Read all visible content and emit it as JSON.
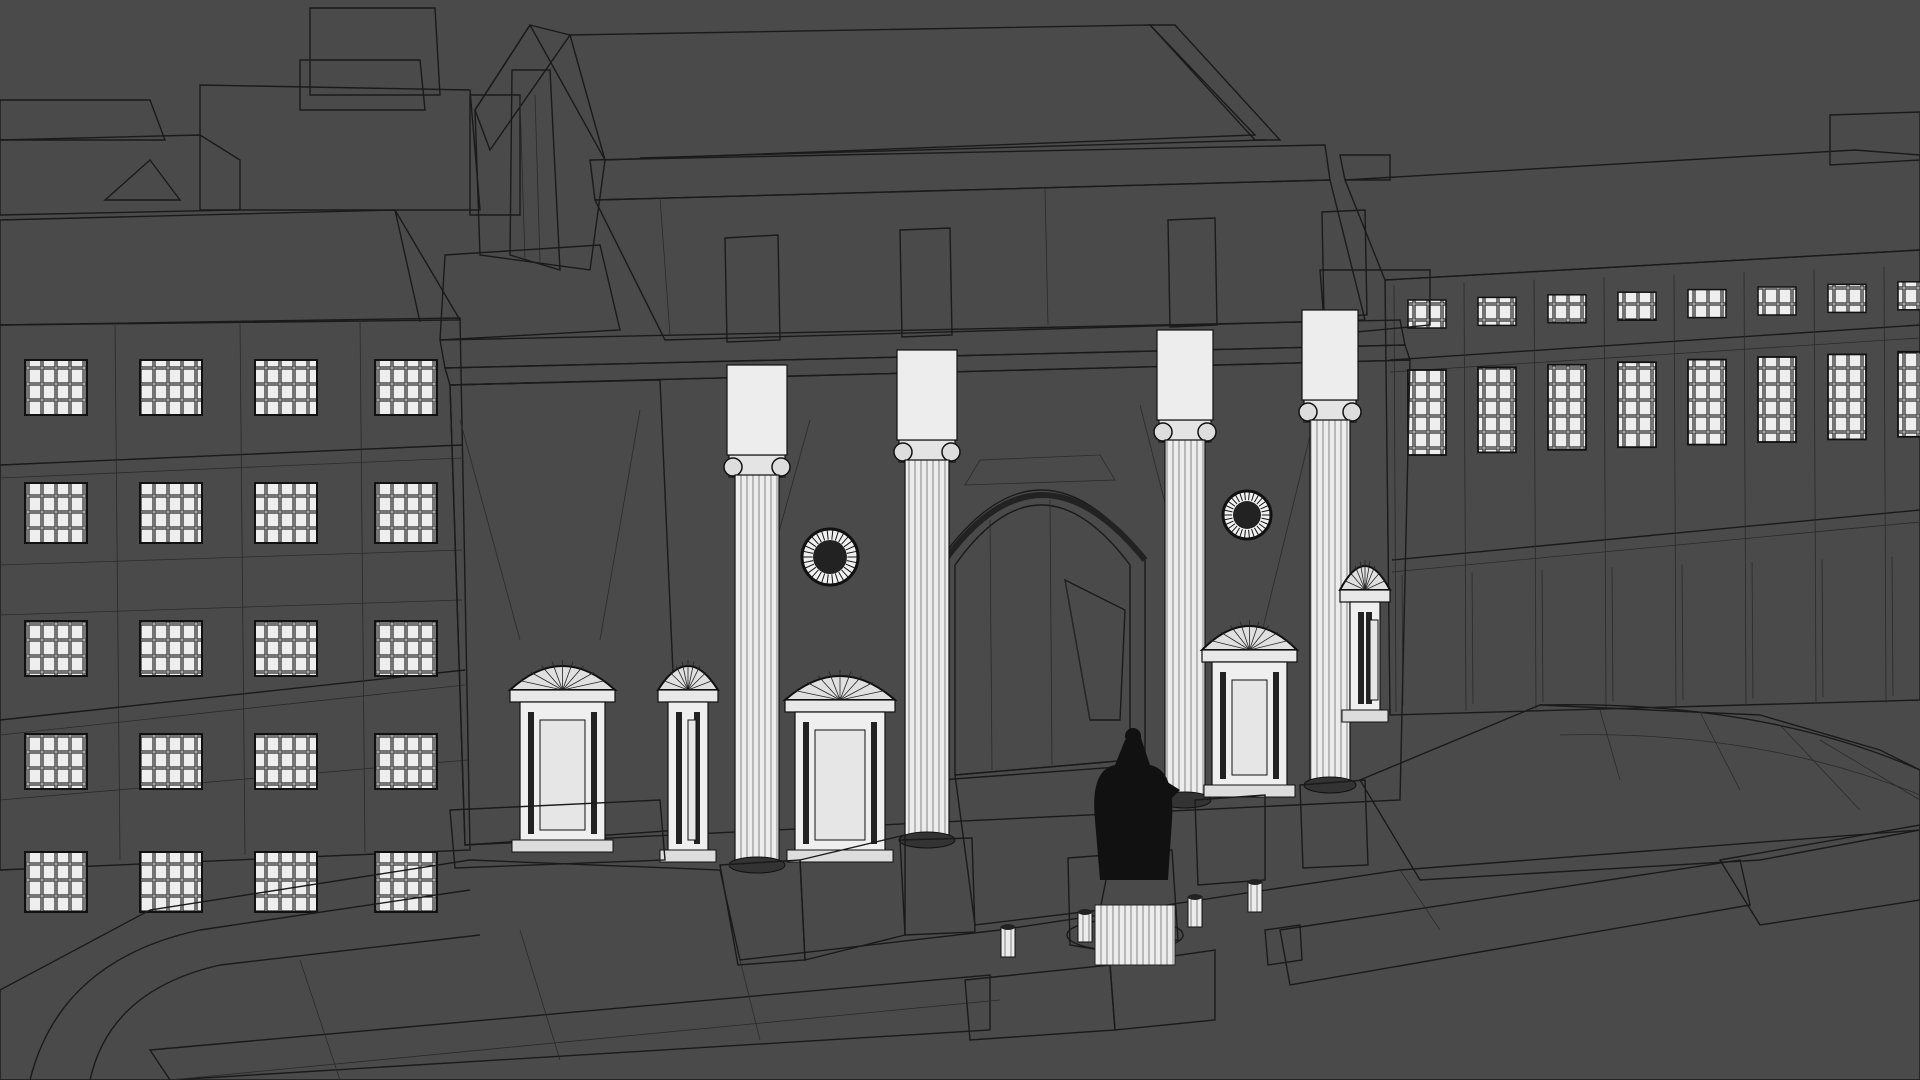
{
  "scene": {
    "kind": "3D wireframe-shaded architectural model render",
    "colors": {
      "background": "#4a4a4a",
      "surface_light": "#f2f2f2",
      "surface_mid": "#e2e2e2",
      "surface_shade": "#cfcfcf",
      "edge_line": "#1a1a1a",
      "window_dark": "#2b2b2b",
      "statue": "#111111"
    },
    "icons": [
      "statue-silhouette",
      "rosette-window",
      "fanlight-pediment",
      "bollard"
    ]
  }
}
